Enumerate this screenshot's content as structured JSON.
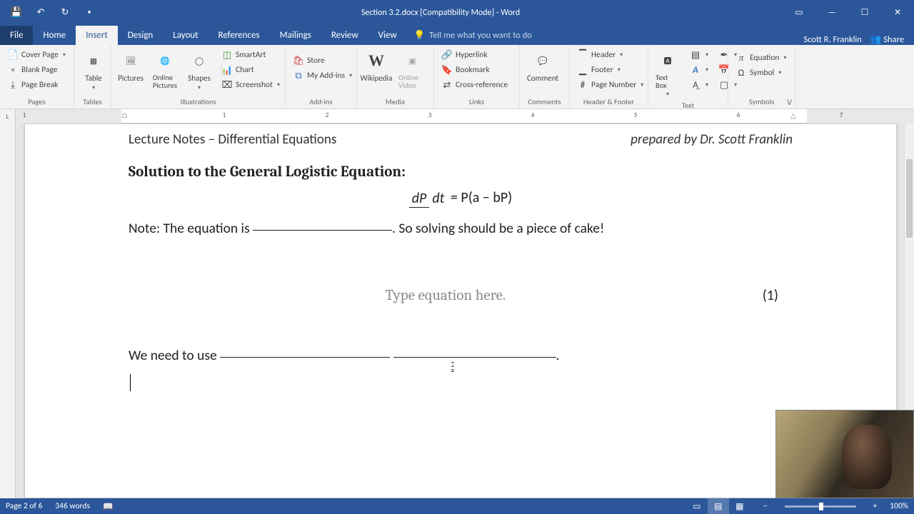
{
  "titlebar": {
    "doc_title": "Section 3.2.docx [Compatibility Mode] - Word"
  },
  "tabs": {
    "file": "File",
    "home": "Home",
    "insert": "Insert",
    "design": "Design",
    "layout": "Layout",
    "references": "References",
    "mailings": "Mailings",
    "review": "Review",
    "view": "View",
    "tell_me": "Tell me what you want to do"
  },
  "user": {
    "name": "Scott R. Franklin",
    "share": "Share"
  },
  "ribbon": {
    "pages": {
      "cover_page": "Cover Page",
      "blank_page": "Blank Page",
      "page_break": "Page Break",
      "group": "Pages"
    },
    "tables": {
      "table": "Table",
      "group": "Tables"
    },
    "illustrations": {
      "pictures": "Pictures",
      "online_pictures": "Online Pictures",
      "shapes": "Shapes",
      "smartart": "SmartArt",
      "chart": "Chart",
      "screenshot": "Screenshot",
      "group": "Illustrations"
    },
    "addins": {
      "store": "Store",
      "my_addins": "My Add-ins",
      "group": "Add-ins"
    },
    "media": {
      "wikipedia": "Wikipedia",
      "online_video": "Online Video",
      "group": "Media"
    },
    "links": {
      "hyperlink": "Hyperlink",
      "bookmark": "Bookmark",
      "cross_ref": "Cross-reference",
      "group": "Links"
    },
    "comments": {
      "comment": "Comment",
      "group": "Comments"
    },
    "header_footer": {
      "header": "Header",
      "footer": "Footer",
      "page_number": "Page Number",
      "group": "Header & Footer"
    },
    "text": {
      "text_box": "Text Box",
      "group": "Text"
    },
    "symbols": {
      "equation": "Equation",
      "symbol": "Symbol",
      "group": "Symbols"
    }
  },
  "ruler": {
    "ticks": [
      "1",
      "2",
      "3",
      "4",
      "5",
      "6",
      "7"
    ]
  },
  "document": {
    "header_left": "Lecture Notes – Differential Equations",
    "header_right": "prepared by Dr. Scott Franklin",
    "heading": "Solution to the General Logistic Equation:",
    "eq_frac_num": "dP",
    "eq_frac_den": "dt",
    "eq_rhs": " = P(a − bP)",
    "note_pre": "Note: The equation is ",
    "note_post": ".  So solving should be a piece of cake!",
    "placeholder": "Type equation here.",
    "eq_number": "(1)",
    "need_pre": "We need to use ",
    "need_post": "."
  },
  "status": {
    "page": "Page 2 of 6",
    "words": "346 words",
    "zoom": "100%"
  }
}
